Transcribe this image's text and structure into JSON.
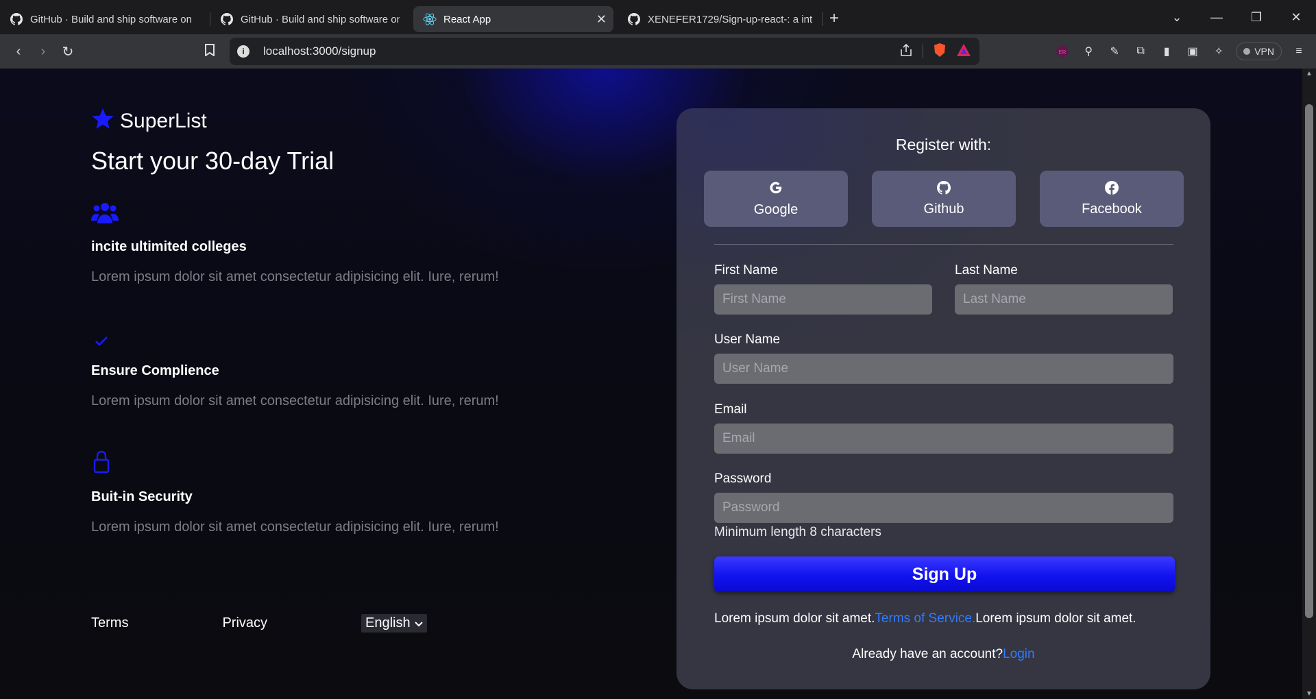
{
  "browser": {
    "tabs": [
      {
        "title": "GitHub · Build and ship software on",
        "icon": "github-icon",
        "active": false
      },
      {
        "title": "GitHub · Build and ship software on",
        "icon": "github-icon",
        "active": false
      },
      {
        "title": "React App",
        "icon": "react-icon",
        "active": true
      },
      {
        "title": "XENEFER1729/Sign-up-react-: a inte",
        "icon": "github-icon",
        "active": false
      }
    ],
    "url": "localhost:3000/signup",
    "vpn_label": "VPN"
  },
  "brand": {
    "name": "SuperList",
    "accent": "#1a1aff"
  },
  "hero_title": "Start your 30-day Trial",
  "features": [
    {
      "icon": "users-icon",
      "title": "incite ultimited colleges",
      "text": "Lorem ipsum dolor sit amet consectetur adipisicing elit. Iure, rerum!"
    },
    {
      "icon": "check-icon",
      "title": "Ensure Complience",
      "text": "Lorem ipsum dolor sit amet consectetur adipisicing elit. Iure, rerum!"
    },
    {
      "icon": "lock-icon",
      "title": "Buit-in Security",
      "text": "Lorem ipsum dolor sit amet consectetur adipisicing elit. Iure, rerum!"
    }
  ],
  "footer": {
    "terms": "Terms",
    "privacy": "Privacy",
    "language": "English"
  },
  "form": {
    "register_with": "Register with:",
    "social": [
      {
        "label": "Google",
        "icon": "google-icon"
      },
      {
        "label": "Github",
        "icon": "github-icon"
      },
      {
        "label": "Facebook",
        "icon": "facebook-icon"
      }
    ],
    "first_name": {
      "label": "First Name",
      "placeholder": "First Name"
    },
    "last_name": {
      "label": "Last Name",
      "placeholder": "Last Name"
    },
    "user_name": {
      "label": "User Name",
      "placeholder": "User Name"
    },
    "email": {
      "label": "Email",
      "placeholder": "Email"
    },
    "password": {
      "label": "Password",
      "placeholder": "Password",
      "hint": "Minimum length 8 characters"
    },
    "submit": "Sign Up",
    "terms_before": "Lorem ipsum dolor sit amet.",
    "terms_link": "Terms of Service.",
    "terms_after": "Lorem ipsum dolor sit amet.",
    "login_prompt": "Already have an account?",
    "login_link": "Login"
  }
}
